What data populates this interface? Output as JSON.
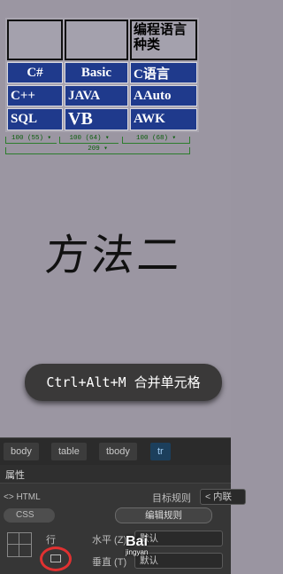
{
  "table": {
    "header": [
      "",
      "",
      "编程语言种类"
    ],
    "rows": [
      [
        "C#",
        "Basic",
        "C语言"
      ],
      [
        "C++",
        "JAVA",
        "AAuto"
      ],
      [
        "SQL",
        "VB",
        "AWK"
      ]
    ],
    "ruler": {
      "columns": [
        "100 (55) ▾",
        "100 (64) ▾",
        "100 (68) ▾"
      ],
      "total": "209 ▾"
    }
  },
  "heading": "方法二",
  "shortcut_hint": "Ctrl+Alt+M 合并单元格",
  "tag_selector": [
    "body",
    "table",
    "tbody",
    "tr"
  ],
  "properties": {
    "title": "属性",
    "html_toggle": "<> HTML",
    "css_toggle": "CSS",
    "target_rule_label": "目标规则",
    "target_rule_value": "< 内联",
    "edit_rule_button": "编辑规则",
    "row_label": "行",
    "horizontal_label": "水平 (Z)",
    "horizontal_value": "默认",
    "vertical_label": "垂直 (T)",
    "vertical_value": "默认"
  },
  "watermark": {
    "brand": "Bai",
    "sub": "jingyan"
  }
}
